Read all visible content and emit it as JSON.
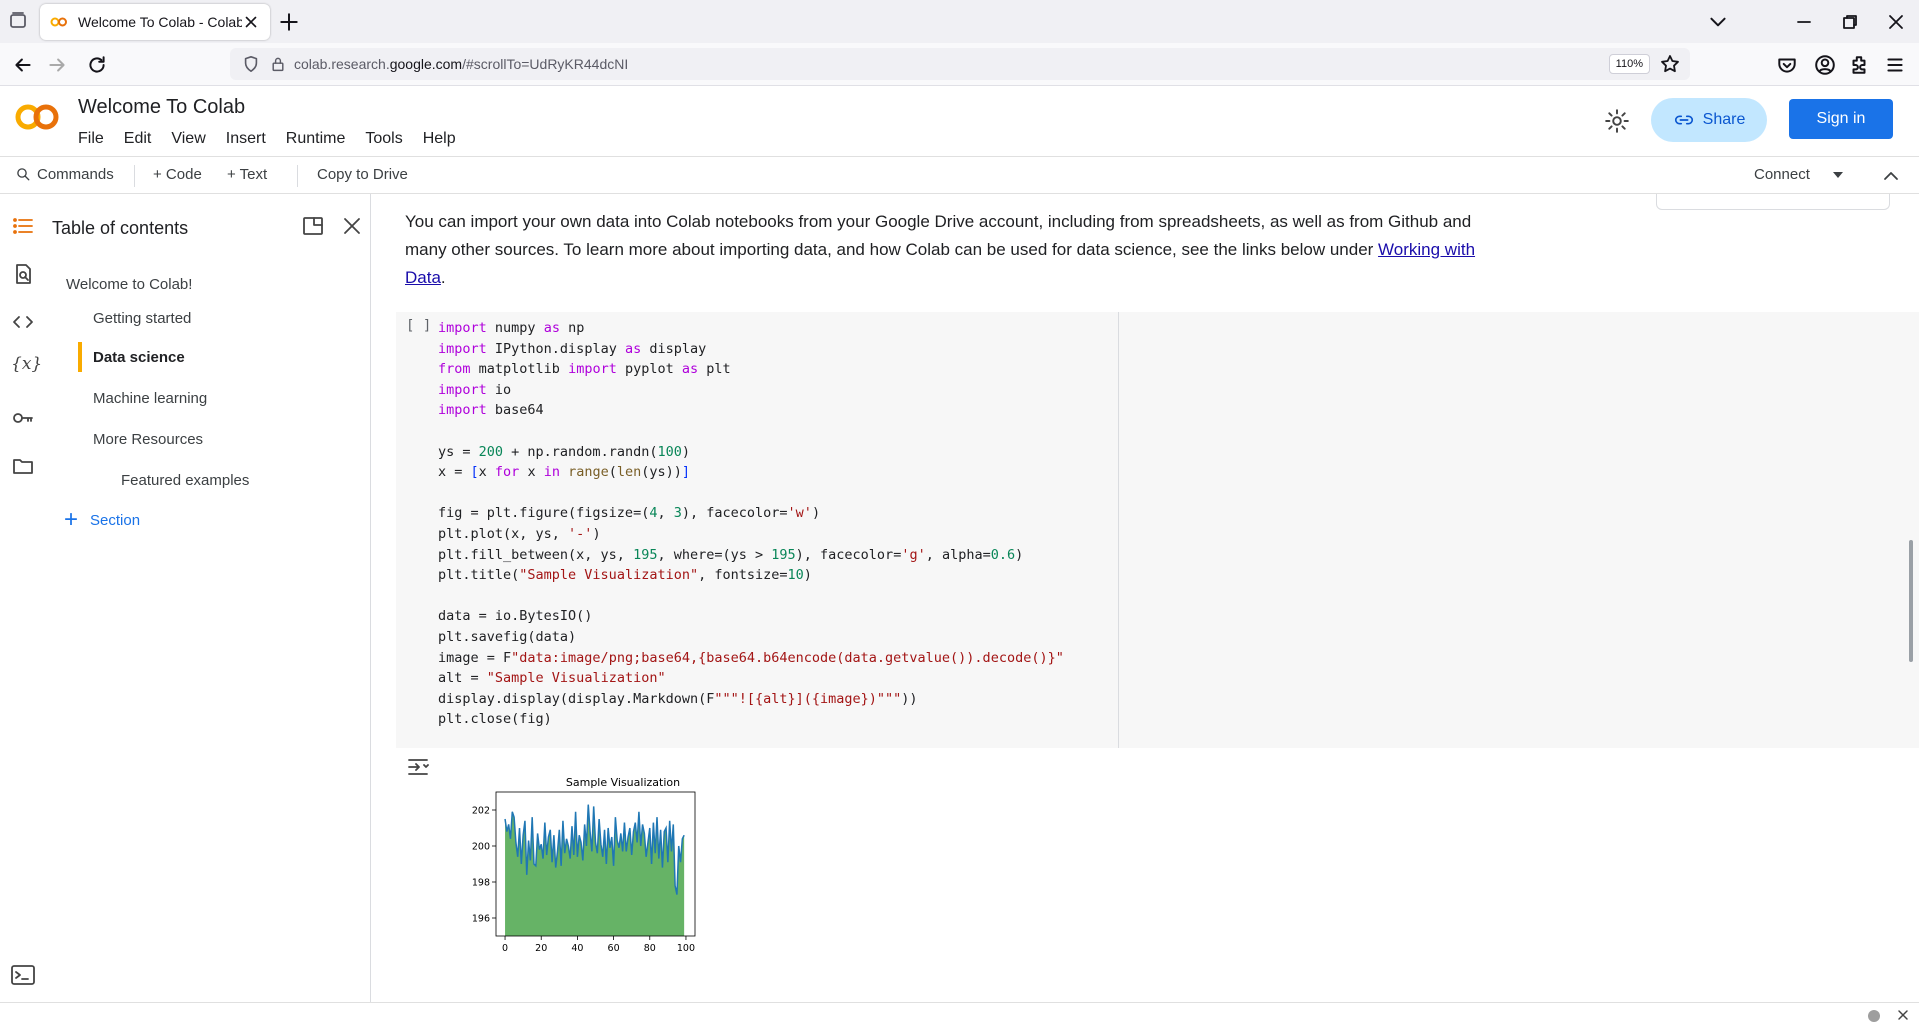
{
  "browser": {
    "tab_title": "Welcome To Colab - Colab",
    "url_prefix": "colab.research.",
    "url_domain": "google.com",
    "url_path": "/#scrollTo=UdRyKR44dcNI",
    "zoom": "110%"
  },
  "colab": {
    "notebook_title": "Welcome To Colab",
    "menu": [
      "File",
      "Edit",
      "View",
      "Insert",
      "Runtime",
      "Tools",
      "Help"
    ],
    "share_label": "Share",
    "signin_label": "Sign in",
    "brand_color": "#f9ab00",
    "accent_color": "#1a73e8"
  },
  "toolbar": {
    "commands": "Commands",
    "code": "+ Code",
    "text": "+ Text",
    "copy_to_drive": "Copy to Drive",
    "connect": "Connect"
  },
  "toc": {
    "title": "Table of contents",
    "items": [
      {
        "label": "Welcome to Colab!",
        "level": 1,
        "active": false
      },
      {
        "label": "Getting started",
        "level": 2,
        "active": false
      },
      {
        "label": "Data science",
        "level": 2,
        "active": true
      },
      {
        "label": "Machine learning",
        "level": 2,
        "active": false
      },
      {
        "label": "More Resources",
        "level": 2,
        "active": false
      },
      {
        "label": "Featured examples",
        "level": 3,
        "active": false
      }
    ],
    "add_section": "Section"
  },
  "content": {
    "intro_text": "You can import your own data into Colab notebooks from your Google Drive account, including from spreadsheets, as well as from Github and many other sources. To learn more about importing data, and how Colab can be used for data science, see the links below under ",
    "intro_link": "Working with Data",
    "intro_end": ".",
    "run_button": "[ ]"
  },
  "chart_data": {
    "type": "area",
    "title": "Sample Visualization",
    "xlim": [
      -5,
      105
    ],
    "ylim": [
      195,
      203
    ],
    "xticks": [
      0,
      20,
      40,
      60,
      80,
      100
    ],
    "yticks": [
      196,
      198,
      200,
      202
    ],
    "fill_baseline": 195,
    "fill_color": "#008000",
    "line_color": "#1f77b4",
    "x": [
      0,
      1,
      2,
      3,
      4,
      5,
      6,
      7,
      8,
      9,
      10,
      11,
      12,
      13,
      14,
      15,
      16,
      17,
      18,
      19,
      20,
      21,
      22,
      23,
      24,
      25,
      26,
      27,
      28,
      29,
      30,
      31,
      32,
      33,
      34,
      35,
      36,
      37,
      38,
      39,
      40,
      41,
      42,
      43,
      44,
      45,
      46,
      47,
      48,
      49,
      50,
      51,
      52,
      53,
      54,
      55,
      56,
      57,
      58,
      59,
      60,
      61,
      62,
      63,
      64,
      65,
      66,
      67,
      68,
      69,
      70,
      71,
      72,
      73,
      74,
      75,
      76,
      77,
      78,
      79,
      80,
      81,
      82,
      83,
      84,
      85,
      86,
      87,
      88,
      89,
      90,
      91,
      92,
      93,
      94,
      95,
      96,
      97,
      98,
      99
    ],
    "y": [
      201.5,
      200.8,
      201.2,
      200.4,
      201.9,
      201.6,
      200.2,
      199.4,
      201.0,
      199.0,
      200.6,
      201.4,
      198.4,
      200.3,
      199.2,
      201.6,
      199.0,
      198.9,
      200.7,
      199.8,
      200.1,
      199.3,
      201.3,
      199.5,
      200.5,
      200.9,
      199.1,
      200.6,
      198.8,
      199.7,
      200.9,
      198.9,
      201.4,
      199.6,
      200.4,
      200.0,
      199.3,
      201.1,
      199.5,
      201.9,
      199.4,
      200.6,
      200.2,
      199.2,
      201.2,
      200.0,
      202.3,
      200.8,
      199.7,
      202.2,
      200.2,
      199.6,
      201.5,
      200.1,
      199.4,
      200.9,
      199.0,
      201.0,
      199.9,
      200.5,
      198.9,
      201.6,
      200.3,
      199.9,
      200.7,
      199.7,
      201.3,
      199.7,
      200.5,
      201.0,
      199.5,
      200.8,
      201.3,
      200.2,
      201.9,
      200.0,
      201.2,
      200.7,
      199.4,
      200.2,
      201.0,
      199.0,
      201.3,
      199.6,
      201.6,
      199.3,
      200.9,
      198.8,
      200.8,
      201.0,
      199.1,
      201.4,
      199.7,
      201.2,
      197.8,
      197.3,
      200.0,
      199.1,
      200.4,
      200.6
    ]
  }
}
